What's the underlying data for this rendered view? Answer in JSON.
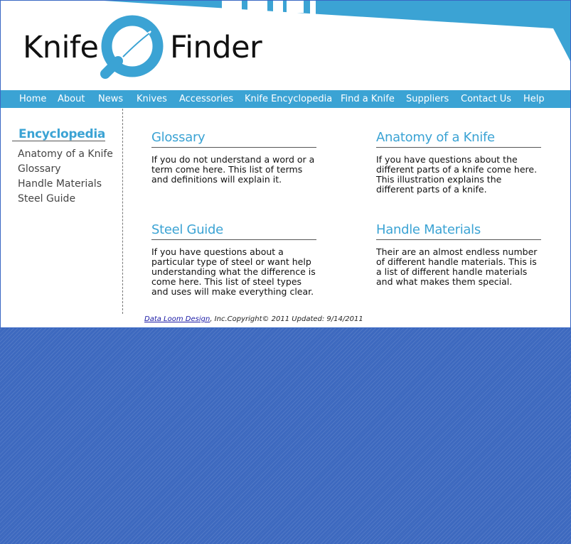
{
  "site": {
    "logo_left": "Knife",
    "logo_right": "Finder",
    "brand_color": "#3ba3d4"
  },
  "nav": {
    "items": [
      "Home",
      "About",
      "News",
      "Knives",
      "Accessories",
      "Knife Encyclopedia",
      "Find a Knife",
      "Suppliers",
      "Contact Us",
      "Help"
    ]
  },
  "sidebar": {
    "title": "Encyclopedia",
    "links": [
      "Anatomy of a Knife",
      "Glossary",
      "Handle Materials",
      "Steel Guide"
    ]
  },
  "content": {
    "glossary": {
      "title": "Glossary",
      "text": "If you do not understand a word or a term come here. This list of terms and definitions will explain it."
    },
    "anatomy": {
      "title": "Anatomy of a Knife",
      "text": "If you have questions about the different parts of a knife come here. This illustration explains the different parts of a knife."
    },
    "steel": {
      "title": "Steel Guide",
      "text": "If you have questions about a particular type of steel or want help understanding what the difference is come here. This list of steel types and uses will make everything clear."
    },
    "handle": {
      "title": "Handle Materials",
      "text": "Their are an almost endless number of different handle materials. This is a list of different handle materials and what makes them special."
    }
  },
  "footer": {
    "link_text": "Data Loom Design",
    "rest_text": ", Inc.Copyright© 2011 Updated: 9/14/2011"
  },
  "colors": {
    "background": "#3d69bf",
    "nav": "#3ba3d4"
  }
}
